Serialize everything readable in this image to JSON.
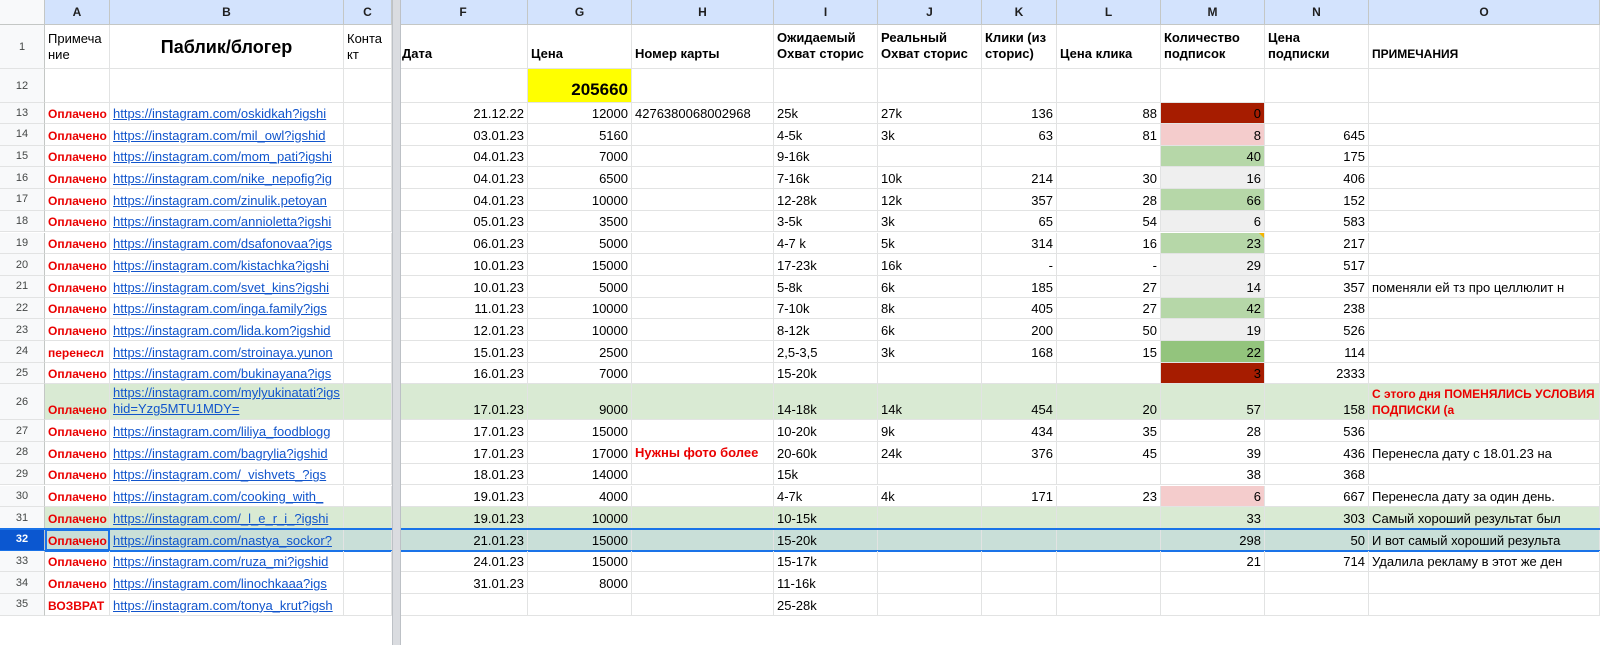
{
  "colors": {
    "green_row": "#d9ead3",
    "green_cell": "#b6d7a8",
    "green_dark": "#93c47d",
    "red_dark": "#a61c00",
    "pink": "#f4cccc",
    "gray_cell": "#efefef",
    "yellow": "#ffff00",
    "selected_row": "#c9dfd8"
  },
  "columns": [
    "A",
    "B",
    "C",
    "F",
    "G",
    "H",
    "I",
    "J",
    "K",
    "L",
    "M",
    "N",
    "O"
  ],
  "header": {
    "row_num": "1",
    "A": "Примеча ние",
    "B": "Паблик/блогер",
    "C": "Конта кт",
    "F": "Дата",
    "G": "Цена",
    "H": "Номер карты",
    "I": "Ожидаемый Охват сторис",
    "J": "Реальный Охват сторис",
    "K": "Клики (из сторис)",
    "L": "Цена клика",
    "M": "Количество подписок",
    "N": "Цена подписки",
    "O": "ПРИМЕЧАНИЯ"
  },
  "total_row": {
    "row_num": "12",
    "G": "205660"
  },
  "rows": [
    {
      "n": "13",
      "A": "Оплачено",
      "B": "https://instagram.com/oskidkah?igshi",
      "F": "21.12.22",
      "G": "12000",
      "H": "4276380068002968",
      "I": "25k",
      "J": "27k",
      "K": "136",
      "L": "88",
      "M": "0",
      "N": "",
      "O": "",
      "m_bg": "red_dark"
    },
    {
      "n": "14",
      "A": "Оплачено",
      "B": "https://instagram.com/mil_owl?igshid",
      "F": "03.01.23",
      "G": "5160",
      "H": "",
      "I": "4-5k",
      "J": "3k",
      "K": "63",
      "L": "81",
      "M": "8",
      "N": "645",
      "O": "",
      "m_bg": "pink"
    },
    {
      "n": "15",
      "A": "Оплачено",
      "B": "https://instagram.com/mom_pati?igshi",
      "F": "04.01.23",
      "G": "7000",
      "H": "",
      "I": "9-16k",
      "J": "",
      "K": "",
      "L": "",
      "M": "40",
      "N": "175",
      "O": "",
      "m_bg": "green_cell"
    },
    {
      "n": "16",
      "A": "Оплачено",
      "B": "https://instagram.com/nike_nepofig?ig",
      "F": "04.01.23",
      "G": "6500",
      "H": "",
      "I": "7-16k",
      "J": "10k",
      "K": "214",
      "L": "30",
      "M": "16",
      "N": "406",
      "O": "",
      "m_bg": "gray_cell"
    },
    {
      "n": "17",
      "A": "Оплачено",
      "B": "https://instagram.com/zinulik.petoyan",
      "F": "04.01.23",
      "G": "10000",
      "H": "",
      "I": "12-28k",
      "J": "12k",
      "K": "357",
      "L": "28",
      "M": "66",
      "N": "152",
      "O": "",
      "m_bg": "green_cell"
    },
    {
      "n": "18",
      "A": "Оплачено",
      "B": "https://instagram.com/annioletta?igshi",
      "F": "05.01.23",
      "G": "3500",
      "H": "",
      "I": "3-5k",
      "J": "3k",
      "K": "65",
      "L": "54",
      "M": "6",
      "N": "583",
      "O": "",
      "m_bg": "gray_cell"
    },
    {
      "n": "19",
      "A": "Оплачено",
      "B": "https://instagram.com/dsafonovaa?igs",
      "F": "06.01.23",
      "G": "5000",
      "H": "",
      "I": "4-7 k",
      "J": "5k",
      "K": "314",
      "L": "16",
      "M": "23",
      "N": "217",
      "O": "",
      "m_bg": "green_cell",
      "flag": true
    },
    {
      "n": "20",
      "A": "Оплачено",
      "B": "https://instagram.com/kistachka?igshi",
      "F": "10.01.23",
      "G": "15000",
      "H": "",
      "I": "17-23k",
      "J": "16k",
      "K": "-",
      "L": "-",
      "M": "29",
      "N": "517",
      "O": "",
      "m_bg": "gray_cell"
    },
    {
      "n": "21",
      "A": "Оплачено",
      "B": "https://instagram.com/svet_kins?igshi",
      "F": "10.01.23",
      "G": "5000",
      "H": "",
      "I": "5-8k",
      "J": "6k",
      "K": "185",
      "L": "27",
      "M": "14",
      "N": "357",
      "O": "поменяли ей тз про целлюлит н",
      "m_bg": "gray_cell"
    },
    {
      "n": "22",
      "A": "Оплачено",
      "B": "https://instagram.com/inga.family?igs",
      "F": "11.01.23",
      "G": "10000",
      "H": "",
      "I": "7-10k",
      "J": "8k",
      "K": "405",
      "L": "27",
      "M": "42",
      "N": "238",
      "O": "",
      "m_bg": "green_cell"
    },
    {
      "n": "23",
      "A": "Оплачено",
      "B": "https://instagram.com/lida.kom?igshid",
      "F": "12.01.23",
      "G": "10000",
      "H": "",
      "I": "8-12k",
      "J": "6k",
      "K": "200",
      "L": "50",
      "M": "19",
      "N": "526",
      "O": "",
      "m_bg": "gray_cell"
    },
    {
      "n": "24",
      "A": "перенесл",
      "B": "https://instagram.com/stroinaya.yunon",
      "F": "15.01.23",
      "G": "2500",
      "H": "",
      "I": "2,5-3,5",
      "J": "3k",
      "K": "168",
      "L": "15",
      "M": "22",
      "N": "114",
      "O": "",
      "m_bg": "green_dark"
    },
    {
      "n": "25",
      "A": "Оплачено",
      "B": "https://instagram.com/bukinayana?igs",
      "F": "16.01.23",
      "G": "7000",
      "H": "",
      "I": "15-20k",
      "J": "",
      "K": "",
      "L": "",
      "M": "3",
      "N": "2333",
      "O": "",
      "m_bg": "red_dark"
    },
    {
      "n": "26",
      "A": "Оплачено",
      "B": "https://instagram.com/mylyukinatati?igshid=Yzg5MTU1MDY=",
      "F": "17.01.23",
      "G": "9000",
      "H": "",
      "I": "14-18k",
      "J": "14k",
      "K": "454",
      "L": "20",
      "M": "57",
      "N": "158",
      "O": "С этого дня ПОМЕНЯЛИСЬ УСЛОВИЯ ПОДПИСКИ (а",
      "row_bg": "green_row",
      "tall": true,
      "o_red": true
    },
    {
      "n": "27",
      "A": "Оплачено",
      "B": "https://instagram.com/liliya_foodblogg",
      "F": "17.01.23",
      "G": "15000",
      "H": "",
      "I": "10-20k",
      "J": "9k",
      "K": "434",
      "L": "35",
      "M": "28",
      "N": "536",
      "O": ""
    },
    {
      "n": "28",
      "A": "Оплачено",
      "B": "https://instagram.com/bagrylia?igshid",
      "F": "17.01.23",
      "G": "17000",
      "H": "Нужны фото более",
      "I": "20-60k",
      "J": "24k",
      "K": "376",
      "L": "45",
      "M": "39",
      "N": "436",
      "O": "Перенесла дату с 18.01.23 на",
      "h_red": true
    },
    {
      "n": "29",
      "A": "Оплачено",
      "B": "https://instagram.com/_vishvets_?igs",
      "F": "18.01.23",
      "G": "14000",
      "H": "",
      "I": "15k",
      "J": "",
      "K": "",
      "L": "",
      "M": "38",
      "N": "368",
      "O": ""
    },
    {
      "n": "30",
      "A": "Оплачено",
      "B": "https://instagram.com/cooking_with_",
      "F": "19.01.23",
      "G": "4000",
      "H": "",
      "I": "4-7k",
      "J": "4k",
      "K": "171",
      "L": "23",
      "M": "6",
      "N": "667",
      "O": "Перенесла дату за один день.",
      "m_bg": "pink"
    },
    {
      "n": "31",
      "A": "Оплачено",
      "B": "https://instagram.com/_l_e_r_i_?igshi",
      "F": "19.01.23",
      "G": "10000",
      "H": "",
      "I": "10-15k",
      "J": "",
      "K": "",
      "L": "",
      "M": "33",
      "N": "303",
      "O": "Самый хороший результат был",
      "row_bg": "green_row"
    },
    {
      "n": "32",
      "A": "Оплачено",
      "B": "https://instagram.com/nastya_sockor?",
      "F": "21.01.23",
      "G": "15000",
      "H": "",
      "I": "15-20k",
      "J": "",
      "K": "",
      "L": "",
      "M": "298",
      "N": "50",
      "O": "И вот самый хороший результа",
      "row_bg": "selected_row",
      "selected": true
    },
    {
      "n": "33",
      "A": "Оплачено",
      "B": "https://instagram.com/ruza_mi?igshid",
      "F": "24.01.23",
      "G": "15000",
      "H": "",
      "I": "15-17k",
      "J": "",
      "K": "",
      "L": "",
      "M": "21",
      "N": "714",
      "O": "Удалила рекламу в этот же ден"
    },
    {
      "n": "34",
      "A": "Оплачено",
      "B": "https://instagram.com/linochkaaa?igs",
      "F": "31.01.23",
      "G": "8000",
      "H": "",
      "I": "11-16k",
      "J": "",
      "K": "",
      "L": "",
      "M": "",
      "N": "",
      "O": ""
    },
    {
      "n": "35",
      "A": "ВОЗВРАТ",
      "B": "https://instagram.com/tonya_krut?igsh",
      "F": "",
      "G": "",
      "H": "",
      "I": "25-28k",
      "J": "",
      "K": "",
      "L": "",
      "M": "",
      "N": "",
      "O": ""
    }
  ]
}
